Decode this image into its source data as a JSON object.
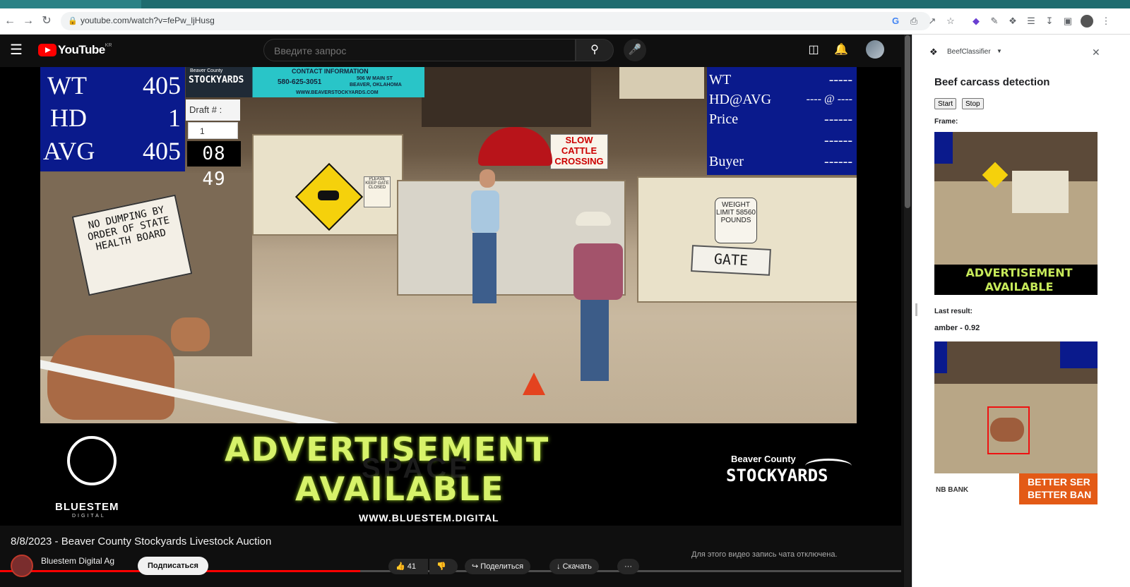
{
  "browser": {
    "url": "youtube.com/watch?v=fePw_ljHusg"
  },
  "youtube": {
    "logo_text": "YouTube",
    "region": "KR",
    "search_placeholder": "Введите запрос",
    "video_title": "8/8/2023 - Beaver County Stockyards Livestock Auction",
    "channel_name": "Bluestem Digital Ag",
    "subscribe_label": "Подписаться",
    "likes": "41",
    "share_label": "Поделиться",
    "download_label": "Скачать",
    "more_label": "···",
    "chat_disabled": "Для этого видео запись чата отключена.",
    "progress_fraction": 0.4
  },
  "video": {
    "left_board": {
      "rows": [
        {
          "label": "WT",
          "value": "405"
        },
        {
          "label": "HD",
          "value": "1"
        },
        {
          "label": "AVG",
          "value": "405"
        }
      ]
    },
    "banner": {
      "brand_top": "Beaver County",
      "brand": "STOCKYARDS",
      "contact_title": "CONTACT INFORMATION",
      "phone": "580-625-3051",
      "address_line1": "506 W MAIN ST",
      "address_line2": "BEAVER, OKLAHOMA",
      "website": "WWW.BEAVERSTOCKYARDS.COM"
    },
    "draft": {
      "label": "Draft # :",
      "value": "1",
      "clock": "08 49"
    },
    "right_board": {
      "rows": [
        {
          "label": "WT",
          "value": "-----"
        },
        {
          "label": "HD@AVG",
          "value": "---- @ ----"
        },
        {
          "label": "Price",
          "value": "------"
        },
        {
          "label": "",
          "value": "------"
        },
        {
          "label": "Buyer",
          "value": "------"
        }
      ]
    },
    "signs": {
      "no_dumping": "NO DUMPING BY ORDER OF STATE HEALTH BOARD",
      "weight_limit": "WEIGHT LIMIT 58560 POUNDS",
      "gate": "GATE",
      "slow": "SLOW CATTLE CROSSING",
      "please_keep": "PLEASE KEEP GATE CLOSED"
    },
    "ad": {
      "line1": "ADVERTISEMENT",
      "line2": "AVAILABLE",
      "space": "SPACE",
      "website": "WWW.BLUESTEM.DIGITAL",
      "left_logo": "BLUESTEM",
      "left_logo_sub": "DIGITAL",
      "right_logo_top": "Beaver County",
      "right_logo": "STOCKYARDS"
    }
  },
  "sidepanel": {
    "extension_name": "BeefClassifier",
    "title": "Beef carcass detection",
    "start_label": "Start",
    "stop_label": "Stop",
    "frame_label": "Frame:",
    "last_result_label": "Last result:",
    "result": "amber - 0.92",
    "thumb1_ad": "ADVERTISEMENT AVAILABLE",
    "thumb2_bank": "NB BANK",
    "thumb2_ad": "BETTER SER BETTER BAN"
  }
}
